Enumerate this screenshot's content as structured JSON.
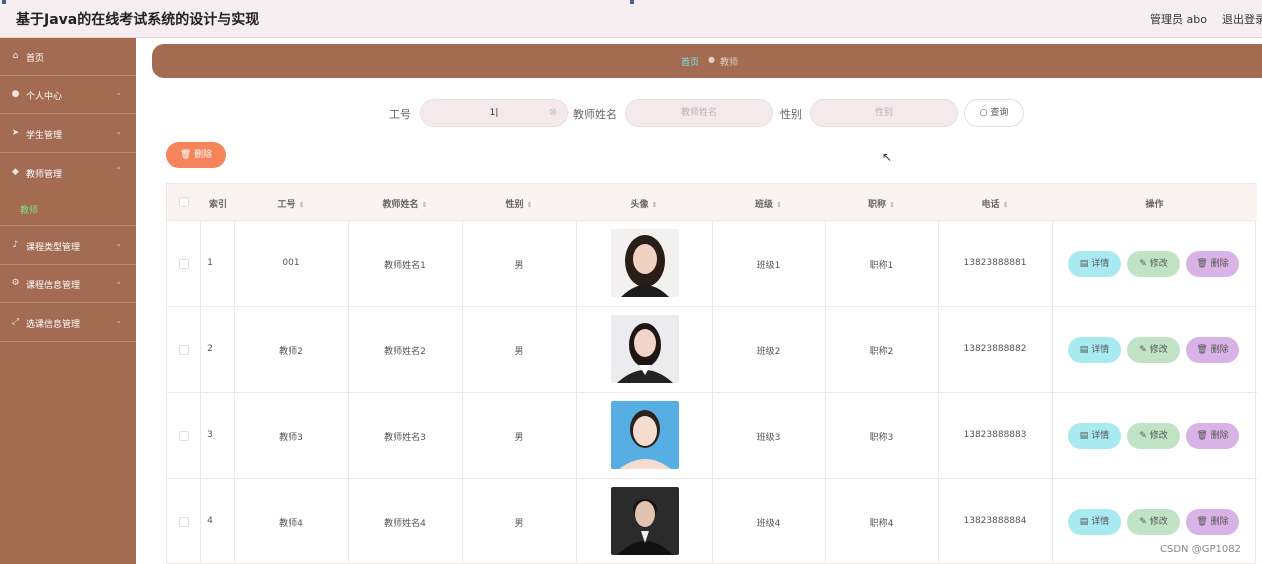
{
  "app": {
    "title": "基于Java的在线考试系统的设计与实现",
    "user": "管理员 abo",
    "logout": "退出登录"
  },
  "sidebar": {
    "items": [
      {
        "label": "首页",
        "icon": "home-icon"
      },
      {
        "label": "个人中心",
        "icon": "user-icon"
      },
      {
        "label": "学生管理",
        "icon": "send-icon"
      },
      {
        "label": "教师管理",
        "icon": "shield-icon"
      },
      {
        "label": "课程类型管理",
        "icon": "mic-icon"
      },
      {
        "label": "课程信息管理",
        "icon": "gear-icon"
      },
      {
        "label": "选课信息管理",
        "icon": "resize-icon"
      }
    ],
    "active_sub": "教师"
  },
  "breadcrumb": {
    "home": "首页",
    "current": "教师"
  },
  "search": {
    "id_label": "工号",
    "id_value": "1",
    "name_label": "教师姓名",
    "name_placeholder": "教师姓名",
    "gender_label": "性别",
    "gender_placeholder": "性别",
    "button": "查询"
  },
  "toolbar": {
    "delete_label": "删除"
  },
  "table": {
    "headers": [
      "索引",
      "工号",
      "教师姓名",
      "性别",
      "头像",
      "班级",
      "职称",
      "电话",
      "操作"
    ],
    "rows": [
      {
        "index": "1",
        "id": "001",
        "name": "教师姓名1",
        "gender": "男",
        "class": "班级1",
        "title": "职称1",
        "phone": "13823888881"
      },
      {
        "index": "2",
        "id": "教师2",
        "name": "教师姓名2",
        "gender": "男",
        "class": "班级2",
        "title": "职称2",
        "phone": "13823888882"
      },
      {
        "index": "3",
        "id": "教师3",
        "name": "教师姓名3",
        "gender": "男",
        "class": "班级3",
        "title": "职称3",
        "phone": "13823888883"
      },
      {
        "index": "4",
        "id": "教师4",
        "name": "教师姓名4",
        "gender": "男",
        "class": "班级4",
        "title": "职称4",
        "phone": "13823888884"
      }
    ],
    "actions": {
      "detail": "详情",
      "edit": "修改",
      "delete": "删除"
    }
  },
  "watermark": "CSDN @GP1082",
  "colors": {
    "sidebar": "#a26b52",
    "accent_green": "#7fe07f",
    "delete_batch": "#f5845a"
  }
}
